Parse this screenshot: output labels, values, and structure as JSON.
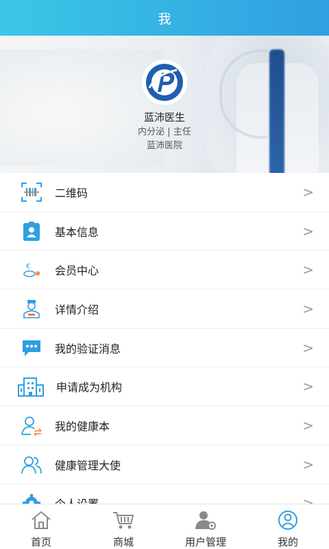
{
  "header": {
    "title": "我"
  },
  "profile": {
    "name": "蓝沛医生",
    "department_title": "内分泌 | 主任",
    "hospital": "蓝沛医院"
  },
  "menu": {
    "items": [
      {
        "label": "二维码",
        "icon": "qr-code-icon"
      },
      {
        "label": "基本信息",
        "icon": "badge-icon"
      },
      {
        "label": "会员中心",
        "icon": "member-icon"
      },
      {
        "label": "详情介绍",
        "icon": "doctor-icon"
      },
      {
        "label": "我的验证消息",
        "icon": "message-icon"
      },
      {
        "label": "申请成为机构",
        "icon": "building-icon"
      },
      {
        "label": "我的健康本",
        "icon": "user-exchange-icon"
      },
      {
        "label": "健康管理大使",
        "icon": "users-icon"
      },
      {
        "label": "个人设置",
        "icon": "gear-icon"
      }
    ],
    "chevron": ">"
  },
  "tabbar": {
    "items": [
      {
        "label": "首页",
        "icon": "home-icon"
      },
      {
        "label": "商城",
        "icon": "cart-icon"
      },
      {
        "label": "用户管理",
        "icon": "user-manage-icon"
      },
      {
        "label": "我的",
        "icon": "profile-icon"
      }
    ]
  },
  "colors": {
    "accent": "#2f9fe0",
    "header_start": "#3cc7e6"
  }
}
